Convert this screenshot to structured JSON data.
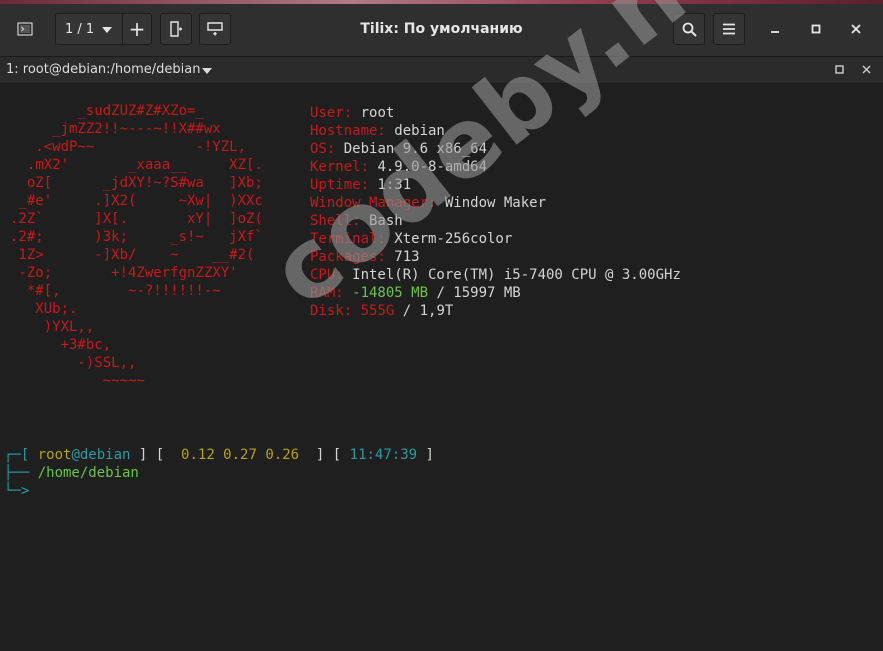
{
  "window": {
    "title": "Tilix: По умолчанию"
  },
  "toolbar": {
    "session_label": "1 / 1",
    "add_label": "+"
  },
  "terminal_tab": {
    "title": "1: root@debian:/home/debian"
  },
  "ascii_logo": [
    "        _sudZUZ#Z#XZo=_",
    "     _jmZZ2!!~---~!!X##wx",
    "   .<wdP~~            -!YZL,",
    "  .mX2'       _xaaa__     XZ[.",
    "  oZ[      _jdXY!~?S#wa   ]Xb;",
    " _#e'     .]X2(     ~Xw|  )XXc",
    ".2Z`      ]X[.       xY|  ]oZ(",
    ".2#;      )3k;     _s!~   jXf`",
    " 1Z>      -]Xb/    ~    __#2(",
    " -Zo;       +!4ZwerfgnZZXY'",
    "  *#[,        ~-?!!!!!!-~",
    "   XUb;.",
    "    )YXL,,",
    "      +3#bc,",
    "        -)SSL,,",
    "           ~~~~~"
  ],
  "sysinfo": [
    {
      "label": "User:",
      "value": " root"
    },
    {
      "label": "Hostname:",
      "value": " debian"
    },
    {
      "label": "OS:",
      "value": " Debian 9.6 x86_64"
    },
    {
      "label": "Kernel:",
      "value": " 4.9.0-8-amd64"
    },
    {
      "label": "Uptime:",
      "value": " 1:31"
    },
    {
      "label": "Window Manager:",
      "value": " Window Maker"
    },
    {
      "label": "Shell:",
      "value": " Bash"
    },
    {
      "label": "Terminal:",
      "value": " Xterm-256color"
    },
    {
      "label": "Packages:",
      "value": " 713"
    },
    {
      "label": "CPU:",
      "value": " Intel(R) Core(TM) i5-7400 CPU @ 3.00GHz"
    }
  ],
  "ram": {
    "label": "RAM:",
    "used": " -14805 MB",
    "rest": " / 15997 MB"
  },
  "disk": {
    "label": "Disk:",
    "used": " 555G",
    "rest": " / 1,9T"
  },
  "prompt": {
    "box_start": "┌─[ ",
    "user": "root",
    "at": "@",
    "host": "debian",
    "sep1": " ] [  ",
    "load1": "0.12",
    "load2": " 0.27",
    "load3": " 0.26",
    "sep2": "  ] [ ",
    "time": "11:47:39",
    "sep3": " ]",
    "line2_prefix": "├── ",
    "path": "/home/debian",
    "line3_prefix": "└─",
    "cursor": ">"
  },
  "watermark": {
    "text": "codeby.net"
  },
  "colors": {
    "accent_red": "#c61a1a",
    "green": "#6ac34a",
    "yellow": "#b7a01c",
    "cyan": "#2a9aa6"
  }
}
